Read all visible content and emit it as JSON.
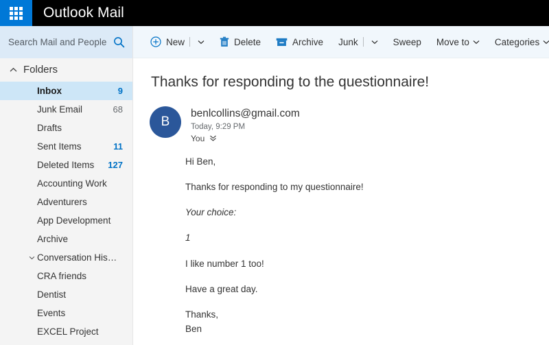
{
  "window": {
    "app_title": "Outlook Mail",
    "waffle_icon": "app-launcher-grid-icon"
  },
  "search": {
    "placeholder": "Search Mail and People",
    "value": "",
    "icon": "search-icon"
  },
  "sidebar": {
    "header": {
      "label": "Folders",
      "icon": "chevron-up-icon"
    },
    "items": [
      {
        "label": "Inbox",
        "count": "9",
        "count_style": "blue",
        "selected": true,
        "twisty": ""
      },
      {
        "label": "Junk Email",
        "count": "68",
        "count_style": "gray",
        "selected": false,
        "twisty": ""
      },
      {
        "label": "Drafts",
        "count": "",
        "count_style": "",
        "selected": false,
        "twisty": ""
      },
      {
        "label": "Sent Items",
        "count": "11",
        "count_style": "blue",
        "selected": false,
        "twisty": ""
      },
      {
        "label": "Deleted Items",
        "count": "127",
        "count_style": "blue",
        "selected": false,
        "twisty": ""
      },
      {
        "label": "Accounting Work",
        "count": "",
        "count_style": "",
        "selected": false,
        "twisty": ""
      },
      {
        "label": "Adventurers",
        "count": "",
        "count_style": "",
        "selected": false,
        "twisty": ""
      },
      {
        "label": "App Development",
        "count": "",
        "count_style": "",
        "selected": false,
        "twisty": ""
      },
      {
        "label": "Archive",
        "count": "",
        "count_style": "",
        "selected": false,
        "twisty": ""
      },
      {
        "label": "Conversation History",
        "count": "",
        "count_style": "",
        "selected": false,
        "twisty": "chevron-down-icon"
      },
      {
        "label": "CRA friends",
        "count": "",
        "count_style": "",
        "selected": false,
        "twisty": ""
      },
      {
        "label": "Dentist",
        "count": "",
        "count_style": "",
        "selected": false,
        "twisty": ""
      },
      {
        "label": "Events",
        "count": "",
        "count_style": "",
        "selected": false,
        "twisty": ""
      },
      {
        "label": "EXCEL Project",
        "count": "",
        "count_style": "",
        "selected": false,
        "twisty": ""
      }
    ]
  },
  "toolbar": {
    "new_label": "New",
    "delete_label": "Delete",
    "archive_label": "Archive",
    "junk_label": "Junk",
    "sweep_label": "Sweep",
    "moveto_label": "Move to",
    "categories_label": "Categories",
    "more_label": "•••"
  },
  "message": {
    "subject": "Thanks for responding to the questionnaire!",
    "avatar_initial": "B",
    "sender": "benlcollins@gmail.com",
    "date": "Today, 9:29 PM",
    "recipients": "You",
    "body": [
      {
        "text": "Hi Ben,",
        "style": "normal"
      },
      {
        "text": "Thanks for responding to my questionnaire!",
        "style": "normal"
      },
      {
        "text": "Your choice:",
        "style": "italic"
      },
      {
        "text": "1",
        "style": "italic"
      },
      {
        "text": "I like number 1 too!",
        "style": "normal"
      },
      {
        "text": "Have a great day.",
        "style": "normal"
      },
      {
        "text": "Thanks,",
        "style": "tight"
      },
      {
        "text": "Ben",
        "style": "last"
      }
    ]
  },
  "colors": {
    "brand_blue": "#0078d7",
    "topbar_black": "#000000",
    "accent_blue": "#0072c6",
    "avatar_blue": "#2b579a",
    "selection_blue": "#cde6f7",
    "search_blue": "#dceaf7",
    "commandbar_blue": "#f1f7fc",
    "sidebar_gray": "#f4f4f4"
  }
}
